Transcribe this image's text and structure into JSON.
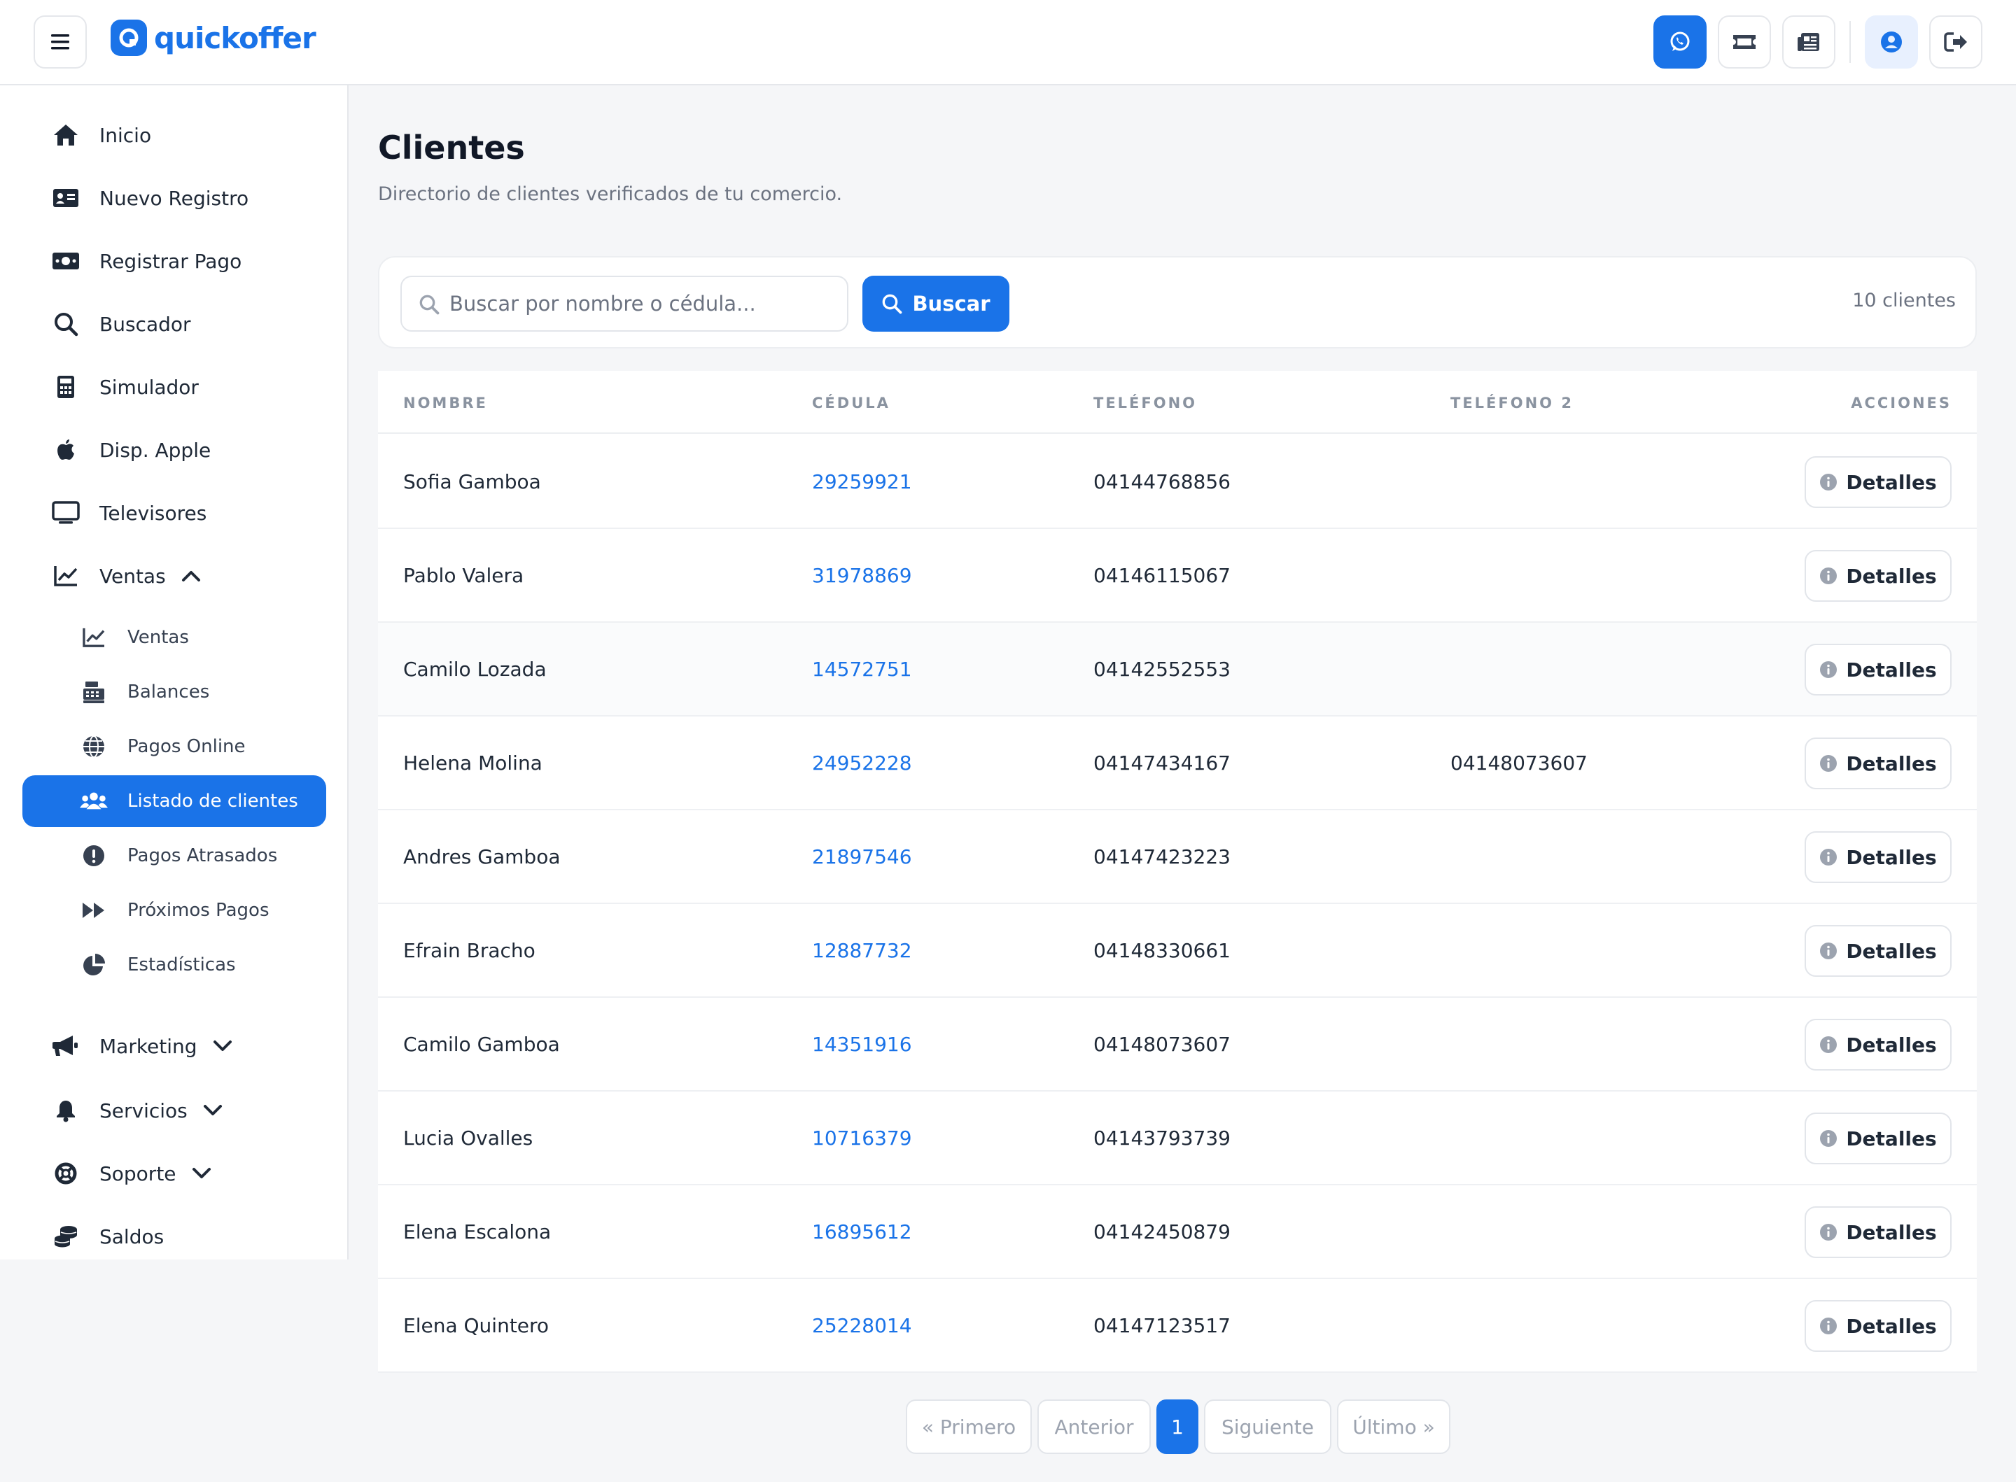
{
  "header": {
    "brand": "quickoffer",
    "menu_icon": "menu-icon",
    "actions": [
      {
        "icon": "whatsapp-icon",
        "variant": "primary"
      },
      {
        "icon": "ticket-icon",
        "variant": "default"
      },
      {
        "icon": "newspaper-icon",
        "variant": "default"
      },
      {
        "icon": "user-circle-icon",
        "variant": "soft"
      },
      {
        "icon": "logout-icon",
        "variant": "default"
      }
    ]
  },
  "sidebar": {
    "items": [
      {
        "label": "Inicio",
        "icon": "home-icon"
      },
      {
        "label": "Nuevo Registro",
        "icon": "id-card-icon"
      },
      {
        "label": "Registrar Pago",
        "icon": "money-bill-icon"
      },
      {
        "label": "Buscador",
        "icon": "search-icon"
      },
      {
        "label": "Simulador",
        "icon": "calculator-icon"
      },
      {
        "label": "Disp. Apple",
        "icon": "apple-icon"
      },
      {
        "label": "Televisores",
        "icon": "tv-icon"
      },
      {
        "label": "Ventas",
        "icon": "chart-line-icon",
        "expanded": true
      }
    ],
    "ventas_sub": [
      {
        "label": "Ventas",
        "icon": "chart-line-icon"
      },
      {
        "label": "Balances",
        "icon": "cash-register-icon"
      },
      {
        "label": "Pagos Online",
        "icon": "globe-icon"
      },
      {
        "label": "Listado de clientes",
        "icon": "users-icon",
        "active": true
      },
      {
        "label": "Pagos Atrasados",
        "icon": "exclamation-circle-icon"
      },
      {
        "label": "Próximos Pagos",
        "icon": "fast-forward-icon"
      },
      {
        "label": "Estadísticas",
        "icon": "pie-chart-icon"
      }
    ],
    "bottom": [
      {
        "label": "Marketing",
        "icon": "megaphone-icon"
      },
      {
        "label": "Servicios",
        "icon": "bell-icon"
      },
      {
        "label": "Soporte",
        "icon": "lifebuoy-icon"
      },
      {
        "label": "Saldos",
        "icon": "coins-icon"
      }
    ]
  },
  "page": {
    "title": "Clientes",
    "subtitle": "Directorio de clientes verificados de tu comercio."
  },
  "search": {
    "placeholder": "Buscar por nombre o cédula...",
    "value": "",
    "button_label": "Buscar",
    "count_label": "10 clientes"
  },
  "table": {
    "headers": [
      "NOMBRE",
      "CÉDULA",
      "TELÉFONO",
      "TELÉFONO 2",
      "ACCIONES"
    ],
    "action_label": "Detalles",
    "rows": [
      {
        "nombre": "Sofia Gamboa",
        "cedula": "29259921",
        "telefono": "04144768856",
        "telefono2": ""
      },
      {
        "nombre": "Pablo Valera",
        "cedula": "31978869",
        "telefono": "04146115067",
        "telefono2": ""
      },
      {
        "nombre": "Camilo Lozada",
        "cedula": "14572751",
        "telefono": "04142552553",
        "telefono2": ""
      },
      {
        "nombre": "Helena Molina",
        "cedula": "24952228",
        "telefono": "04147434167",
        "telefono2": "04148073607"
      },
      {
        "nombre": "Andres Gamboa",
        "cedula": "21897546",
        "telefono": "04147423223",
        "telefono2": ""
      },
      {
        "nombre": "Efrain Bracho",
        "cedula": "12887732",
        "telefono": "04148330661",
        "telefono2": ""
      },
      {
        "nombre": "Camilo Gamboa",
        "cedula": "14351916",
        "telefono": "04148073607",
        "telefono2": ""
      },
      {
        "nombre": "Lucia Ovalles",
        "cedula": "10716379",
        "telefono": "04143793739",
        "telefono2": ""
      },
      {
        "nombre": "Elena Escalona",
        "cedula": "16895612",
        "telefono": "04142450879",
        "telefono2": ""
      },
      {
        "nombre": "Elena Quintero",
        "cedula": "25228014",
        "telefono": "04147123517",
        "telefono2": ""
      }
    ]
  },
  "pagination": {
    "first": "« Primero",
    "prev": "Anterior",
    "current": "1",
    "next": "Siguiente",
    "last": "Último »"
  },
  "colors": {
    "accent": "#1a73e8",
    "text": "#1f2937",
    "muted": "#6b7280",
    "border": "#e5e7eb"
  }
}
